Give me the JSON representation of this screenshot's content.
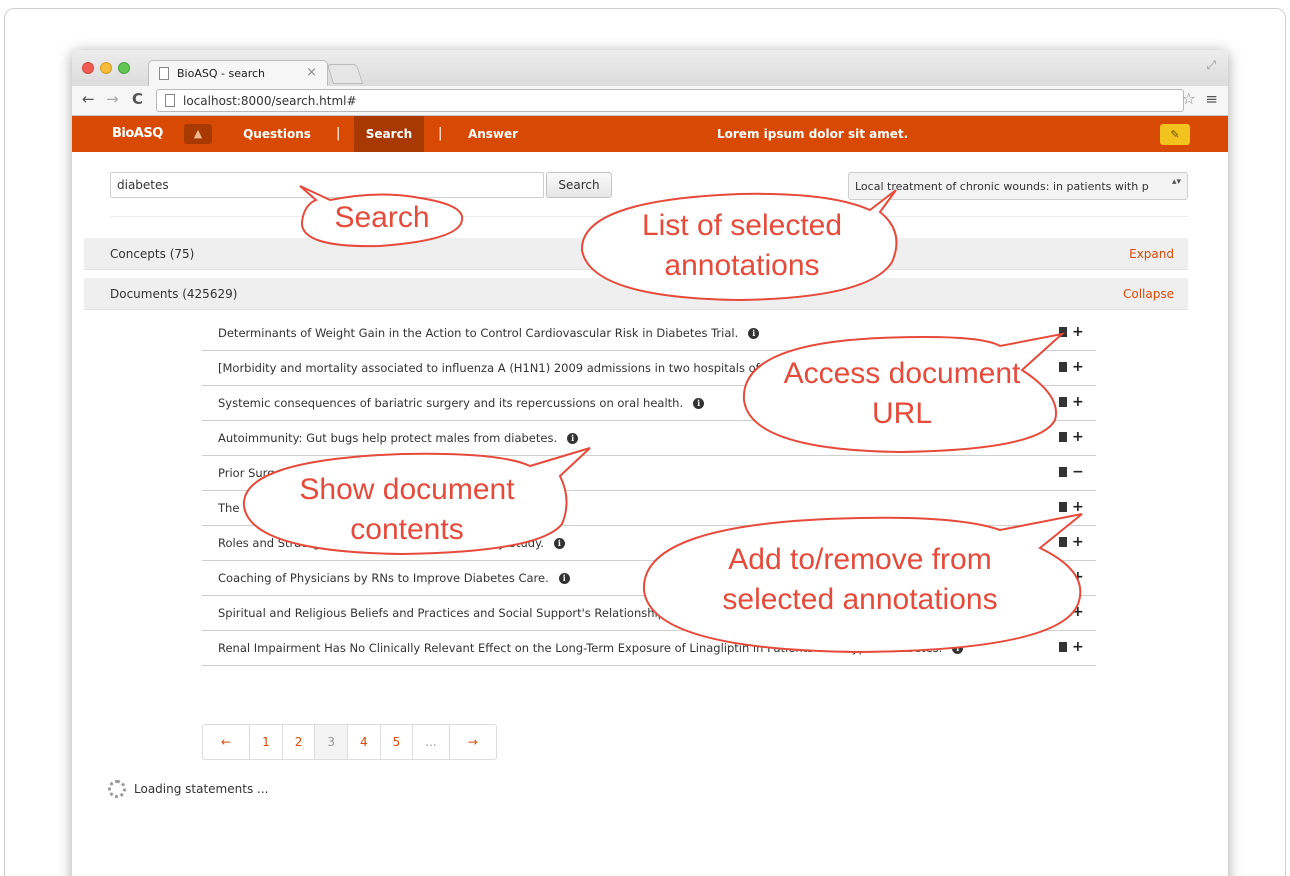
{
  "browser": {
    "tab_title": "BioASQ - search",
    "tab_close": "×",
    "url": "localhost:8000/search.html#",
    "back_icon": "←",
    "forward_icon": "→",
    "reload_icon": "C",
    "star_icon": "☆",
    "menu_icon": "≡",
    "resize_icon": "⤢"
  },
  "navbar": {
    "brand": "BioASQ",
    "user_icon": "▲",
    "items": [
      {
        "label": "Questions"
      },
      {
        "label": "Search"
      },
      {
        "label": "Answer"
      }
    ],
    "separator": "|",
    "message": "Lorem ipsum dolor sit amet.",
    "edit_icon": "✎",
    "color": "#d84a04"
  },
  "search": {
    "value": "diabetes",
    "button_label": "Search"
  },
  "annotation_select": {
    "value": "Local treatment of chronic wounds: in patients with p",
    "caret": "▴▾"
  },
  "panels": {
    "concepts": {
      "title": "Concepts (75)",
      "action": "Expand"
    },
    "documents": {
      "title": "Documents (425629)",
      "action": "Collapse"
    }
  },
  "documents": [
    {
      "title": "Determinants of Weight Gain in the Action to Control Cardiovascular Risk in Diabetes Trial.",
      "toggle": "+"
    },
    {
      "title": "[Morbidity and mortality associated to influenza A (H1N1) 2009 admissions in two hospitals of the analysis of its economic impact].",
      "toggle": "+"
    },
    {
      "title": "Systemic consequences of bariatric surgery and its repercussions on oral health.",
      "toggle": "+"
    },
    {
      "title": "Autoimmunity: Gut bugs help protect males from diabetes.",
      "toggle": "+"
    },
    {
      "title": "Prior Surgery ... in Patients With Chronic Pancreatitis.",
      "toggle": "−"
    },
    {
      "title": "The ... Hypertensive Patients: The AVA-E Study.",
      "toggle": "+"
    },
    {
      "title": "Roles and Strategies ... Educators: An Exploratory Study.",
      "toggle": "+"
    },
    {
      "title": "Coaching of Physicians by RNs to Improve Diabetes Care.",
      "toggle": "+"
    },
    {
      "title": "Spiritual and Religious Beliefs and Practices and Social Support's Relationship ... Americans.",
      "toggle": "+"
    },
    {
      "title": "Renal Impairment Has No Clinically Relevant Effect on the Long-Term Exposure of Linagliptin in Patients With Type 2 Diabetes.",
      "toggle": "+"
    }
  ],
  "info_glyph": "i",
  "pagination": {
    "prev": "←",
    "pages": [
      "1",
      "2",
      "3",
      "4",
      "5"
    ],
    "active_page": "3",
    "ellipsis": "...",
    "next": "→"
  },
  "loading_text": "Loading statements ...",
  "callouts": {
    "search": "Search",
    "selected_annotations": "List of selected annotations",
    "document_url": "Access document URL",
    "document_contents": "Show document contents",
    "add_remove": "Add to/remove from selected annotations",
    "color": "#e64a3a"
  }
}
